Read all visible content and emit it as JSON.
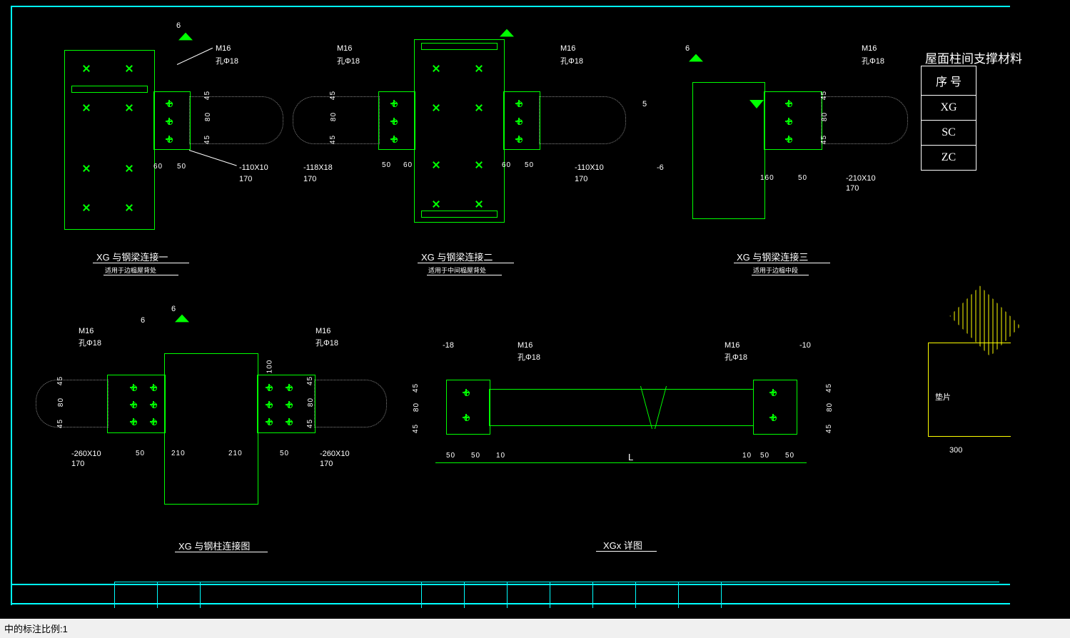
{
  "titles": {
    "d1": "XG 与钢梁连接一",
    "d1s": "适用于边榀屋背处",
    "d2": "XG 与钢梁连接二",
    "d2s": "适用于中间榀屋背处",
    "d3": "XG 与钢梁连接三",
    "d3s": "适用于边榀中段",
    "d4": "XG 与钢柱连接图",
    "d5": "XGx 详图",
    "table_title": "屋面柱间支撑材料"
  },
  "labels": {
    "m16": "M16",
    "hole18": "孔Φ18",
    "p110": "-110X10",
    "p118": "-118X18",
    "p210": "-210X10",
    "p260": "-260X10",
    "n6": "-6",
    "n10": "-10",
    "n18": "-18",
    "L": "L",
    "lab300": "300",
    "pad": "垫片"
  },
  "dims": {
    "d170": "170",
    "d60": "60",
    "d50": "50",
    "d45": "45",
    "d80": "80",
    "d160": "160",
    "d210": "210",
    "d100": "100",
    "d10": "10",
    "d5": "5",
    "d6": "6"
  },
  "table": {
    "r0": "序 号",
    "r1": "XG",
    "r2": "SC",
    "r3": "ZC"
  },
  "cmd": "中的标注比例:1"
}
